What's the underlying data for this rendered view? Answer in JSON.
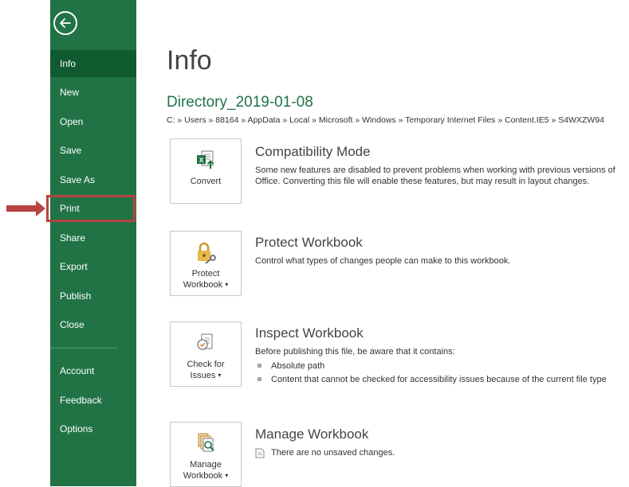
{
  "sidebar": {
    "items": [
      {
        "label": "Info"
      },
      {
        "label": "New"
      },
      {
        "label": "Open"
      },
      {
        "label": "Save"
      },
      {
        "label": "Save As"
      },
      {
        "label": "Print"
      },
      {
        "label": "Share"
      },
      {
        "label": "Export"
      },
      {
        "label": "Publish"
      },
      {
        "label": "Close"
      },
      {
        "label": "Account"
      },
      {
        "label": "Feedback"
      },
      {
        "label": "Options"
      }
    ],
    "active": "Info",
    "highlighted": "Print"
  },
  "main": {
    "title": "Info",
    "document_name": "Directory_2019-01-08",
    "document_path": "C: » Users » 88164 » AppData » Local » Microsoft » Windows » Temporary Internet Files » Content.IE5 » S4WXZW94",
    "sections": [
      {
        "tile": {
          "line1": "Convert",
          "line2": ""
        },
        "heading": "Compatibility Mode",
        "description": "Some new features are disabled to prevent problems when working with previous versions of Office. Converting this file will enable these features, but may result in layout changes."
      },
      {
        "tile": {
          "line1": "Protect",
          "line2": "Workbook"
        },
        "heading": "Protect Workbook",
        "description": "Control what types of changes people can make to this workbook."
      },
      {
        "tile": {
          "line1": "Check for",
          "line2": "Issues"
        },
        "heading": "Inspect Workbook",
        "description": "Before publishing this file, be aware that it contains:",
        "bullets": [
          "Absolute path",
          "Content that cannot be checked for accessibility issues because of the current file type"
        ]
      },
      {
        "tile": {
          "line1": "Manage",
          "line2": "Workbook"
        },
        "heading": "Manage Workbook",
        "note": "There are no unsaved changes."
      }
    ]
  },
  "colors": {
    "sidebar_bg": "#217346",
    "sidebar_active": "#0f5a2e",
    "accent_title": "#217346",
    "annotation": "#b84342"
  },
  "icons": [
    "back-arrow-icon",
    "excel-convert-icon",
    "lock-key-icon",
    "inspect-document-icon",
    "manage-versions-icon",
    "document-icon"
  ]
}
